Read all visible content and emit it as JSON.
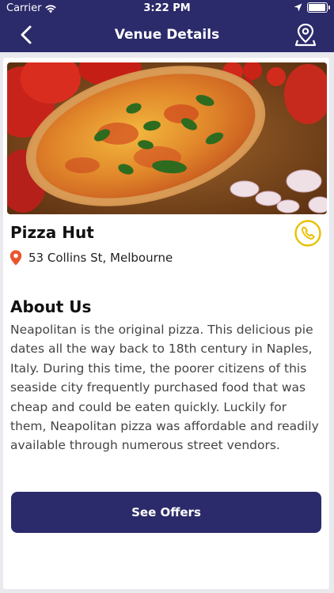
{
  "status_bar": {
    "carrier": "Carrier",
    "time": "3:22 PM",
    "battery_level": 0.95
  },
  "nav": {
    "title": "Venue Details"
  },
  "venue": {
    "name": "Pizza Hut",
    "address": "53 Collins St, Melbourne"
  },
  "about": {
    "heading": "About Us",
    "text": "Neapolitan is the original pizza. This delicious pie dates all the way back to 18th century in Naples, Italy. During this time, the poorer citizens of this seaside city frequently purchased food that was cheap and could be eaten quickly. Luckily for them, Neapolitan pizza was affordable and readily available through numerous street vendors."
  },
  "actions": {
    "offers_label": "See Offers"
  },
  "colors": {
    "primary": "#2b2a6a",
    "accent_yellow": "#e8c100",
    "pin_orange": "#e8552d"
  },
  "icons": [
    "wifi-icon",
    "location-arrow-icon",
    "battery-icon",
    "back-chevron-icon",
    "map-pin-user-icon",
    "phone-icon",
    "location-pin-icon"
  ]
}
